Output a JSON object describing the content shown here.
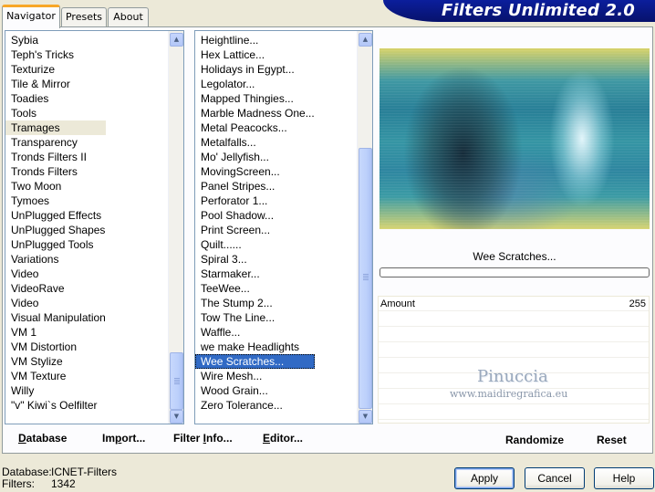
{
  "tabs": [
    {
      "label": "Navigator",
      "active": true
    },
    {
      "label": "Presets",
      "active": false
    },
    {
      "label": "About",
      "active": false
    }
  ],
  "banner": {
    "title": "Filters Unlimited 2.0"
  },
  "category_list": {
    "items": [
      "Sybia",
      "Teph's Tricks",
      "Texturize",
      "Tile & Mirror",
      "Toadies",
      "Tools",
      "Tramages",
      "Transparency",
      "Tronds Filters II",
      "Tronds Filters",
      "Two Moon",
      "Tymoes",
      "UnPlugged Effects",
      "UnPlugged Shapes",
      "UnPlugged Tools",
      "Variations",
      "Video",
      "VideoRave",
      "Video",
      "Visual Manipulation",
      "VM 1",
      "VM Distortion",
      "VM Stylize",
      "VM Texture",
      "Willy",
      "\"v\" Kiwi`s Oelfilter"
    ],
    "selected": "Tramages",
    "scroll_position": 0.93
  },
  "filter_list": {
    "items": [
      "Heightline...",
      "Hex Lattice...",
      "Holidays in Egypt...",
      "Legolator...",
      "Mapped Thingies...",
      "Marble Madness One...",
      "Metal Peacocks...",
      "Metalfalls...",
      "Mo' Jellyfish...",
      "MovingScreen...",
      "Panel Stripes...",
      "Perforator 1...",
      "Pool Shadow...",
      "Print Screen...",
      "Quilt......",
      "Spiral 3...",
      "Starmaker...",
      "TeeWee...",
      "The Stump 2...",
      "Tow The Line...",
      "Waffle...",
      "we make Headlights",
      "Wee Scratches...",
      "Wire Mesh...",
      "Wood Grain...",
      "Zero Tolerance..."
    ],
    "selected": "Wee Scratches...",
    "scroll_position": 1.0
  },
  "left_buttons": {
    "database": {
      "hotkey": "D",
      "rest": "atabase"
    },
    "import": {
      "pre": "Im",
      "hotkey": "p",
      "rest": "ort..."
    },
    "filter_info": {
      "pre": "Filter ",
      "hotkey": "I",
      "rest": "nfo..."
    },
    "editor": {
      "hotkey": "E",
      "rest": "ditor..."
    }
  },
  "preview": {
    "filter_name": "Wee Scratches...",
    "progress": 0
  },
  "parameters": [
    {
      "name": "Amount",
      "value": "255"
    }
  ],
  "watermark": {
    "name": "Pinuccia",
    "site": "www.maidiregrafica.eu"
  },
  "right_buttons": {
    "randomize": "Randomize",
    "reset": "Reset"
  },
  "status": {
    "database_label": "Database:",
    "database_value": "ICNET-Filters",
    "filters_label": "Filters:",
    "filters_value": "1342"
  },
  "dialog_buttons": {
    "apply": "Apply",
    "cancel": "Cancel",
    "help": "Help"
  }
}
